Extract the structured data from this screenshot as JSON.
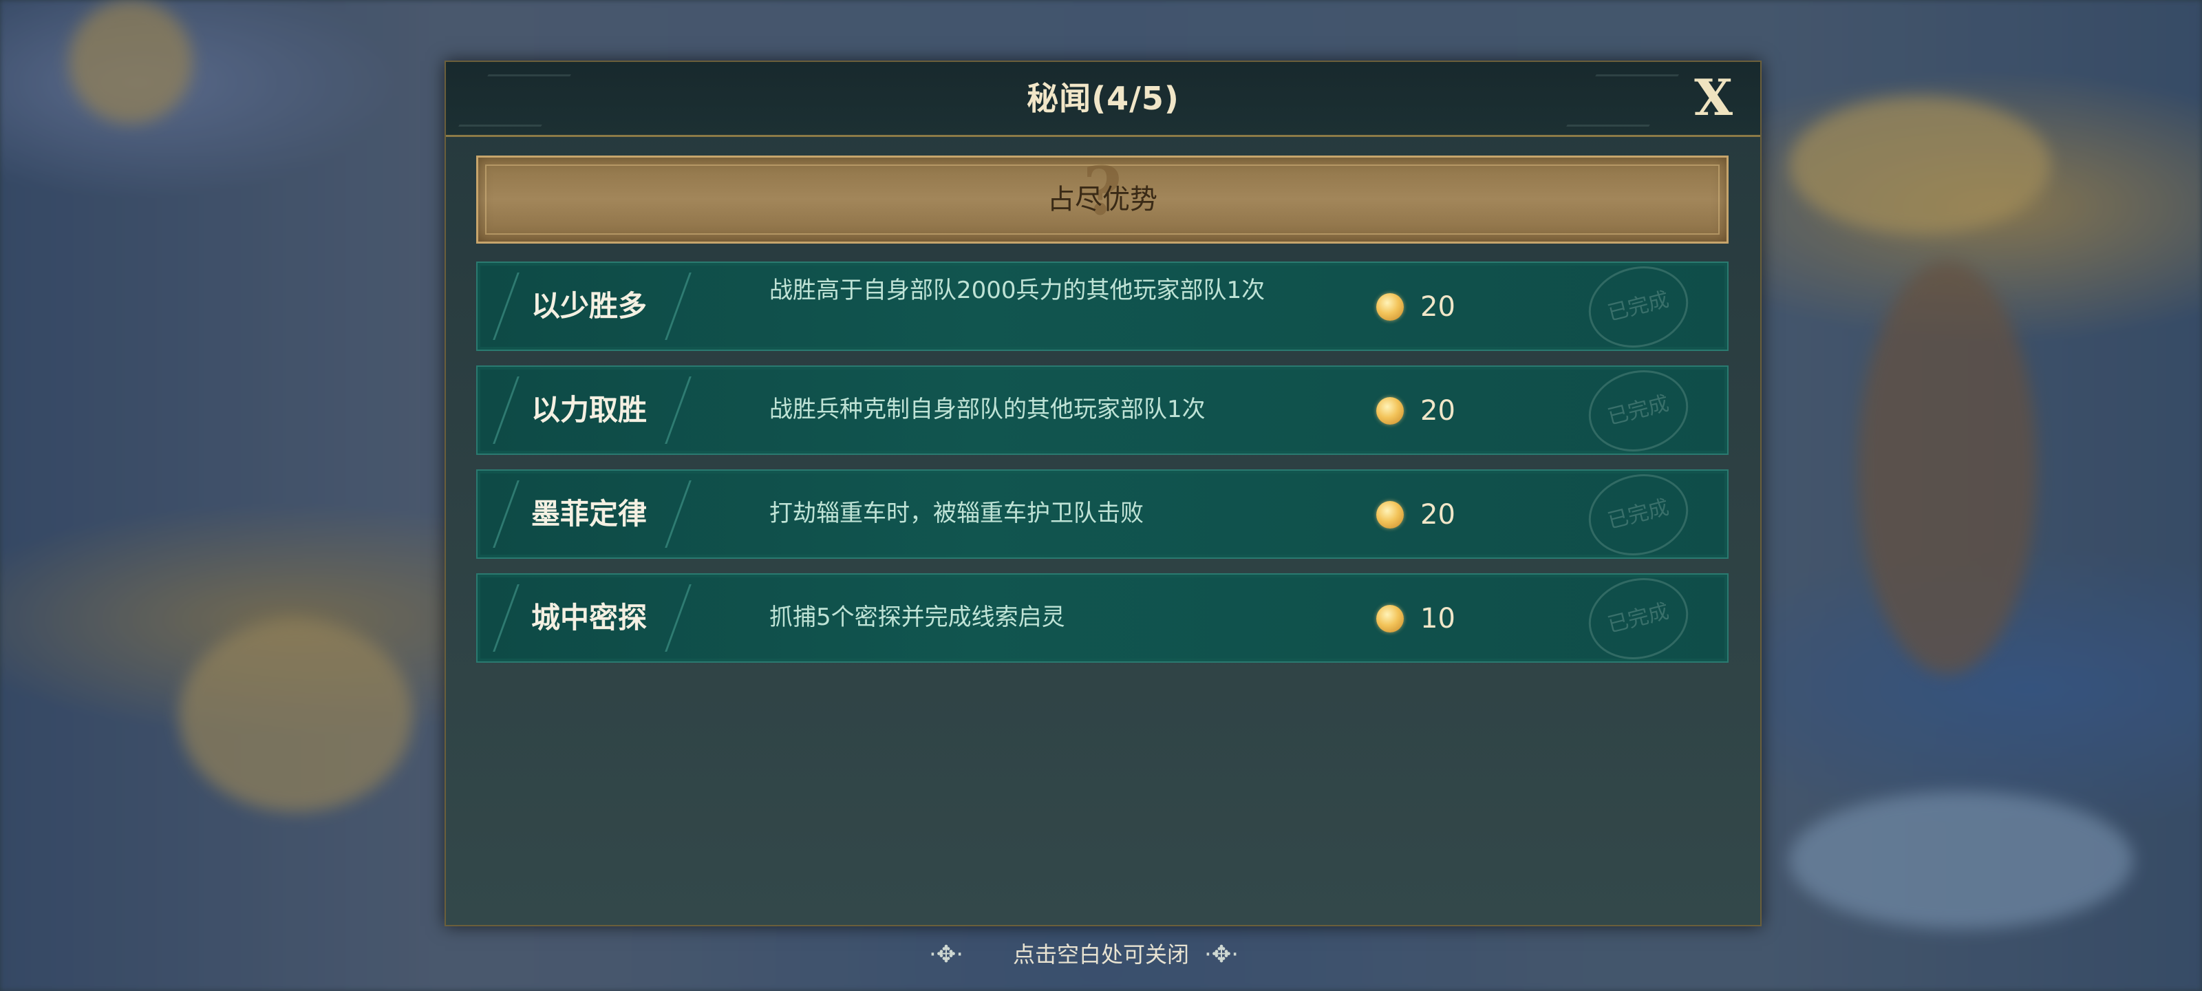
{
  "dialog": {
    "title": "秘闻(4/5)",
    "close_label": "X",
    "category_label": "占尽优势",
    "category_icon": "?"
  },
  "achievements": [
    {
      "name": "以少胜多",
      "description": "战胜高于自身部队2000兵力的其他玩家部队1次",
      "reward": "20",
      "status": "已完成"
    },
    {
      "name": "以力取胜",
      "description": "战胜兵种克制自身部队的其他玩家部队1次",
      "reward": "20",
      "status": "已完成"
    },
    {
      "name": "墨菲定律",
      "description": "打劫辎重车时，被辎重车护卫队击败",
      "reward": "20",
      "status": "已完成"
    },
    {
      "name": "城中密探",
      "description": "抓捕5个密探并完成线索启灵",
      "reward": "10",
      "status": "已完成"
    }
  ],
  "footer": {
    "hint": "点击空白处可关闭"
  },
  "colors": {
    "row_bg": "#11554f",
    "banner_bg": "#a2865a",
    "title_text": "#f1e6c8",
    "coin": "#f3c45a"
  }
}
